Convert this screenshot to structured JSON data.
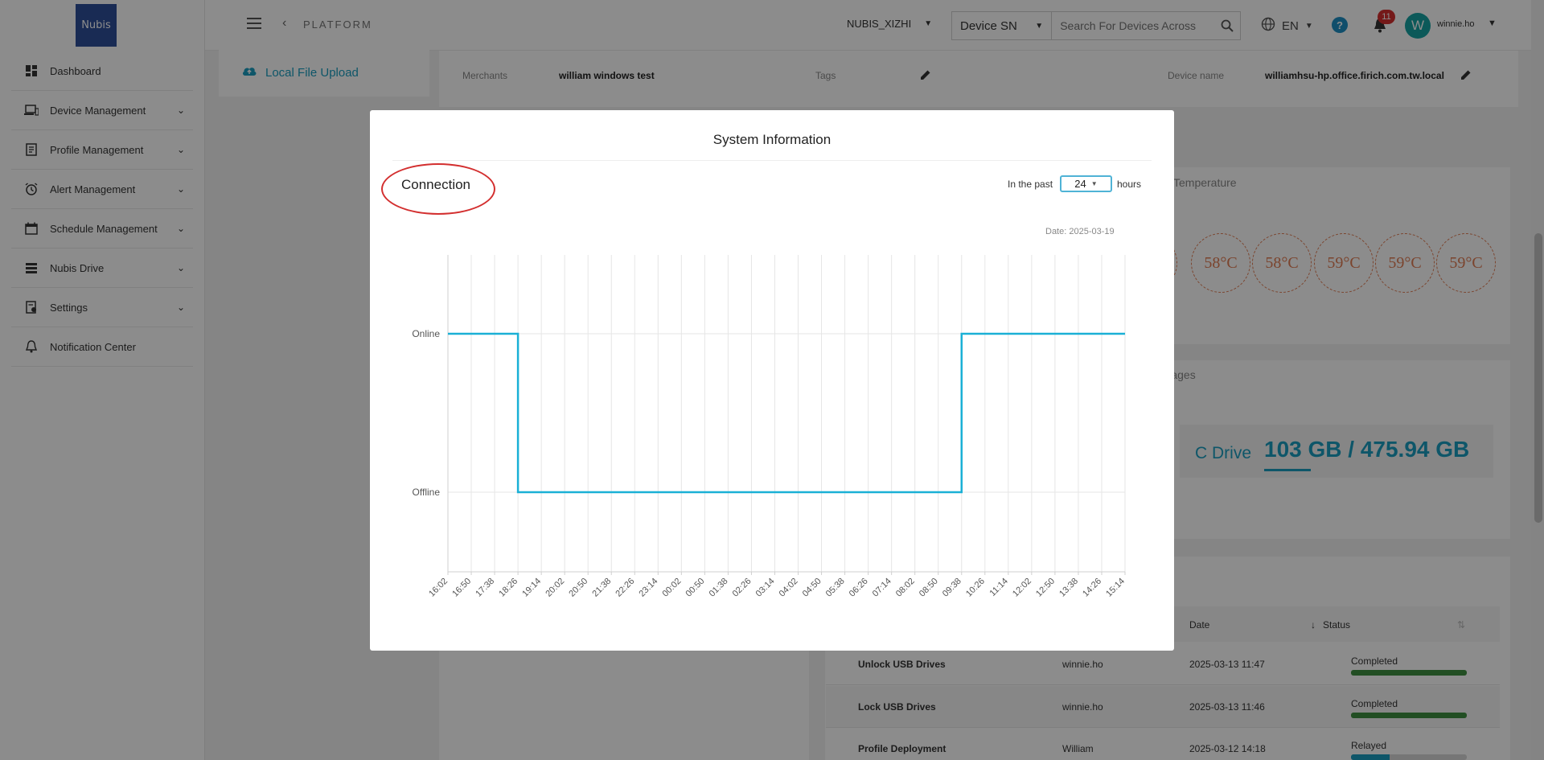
{
  "sidebar": {
    "logo_text": "Nubis",
    "items": [
      {
        "label": "Dashboard",
        "icon": "dashboard-icon",
        "has_children": false
      },
      {
        "label": "Device Management",
        "icon": "device-icon",
        "has_children": true
      },
      {
        "label": "Profile Management",
        "icon": "profile-icon",
        "has_children": true
      },
      {
        "label": "Alert Management",
        "icon": "alarm-icon",
        "has_children": true
      },
      {
        "label": "Schedule Management",
        "icon": "calendar-icon",
        "has_children": true
      },
      {
        "label": "Nubis Drive",
        "icon": "drive-icon",
        "has_children": true
      },
      {
        "label": "Settings",
        "icon": "settings-icon",
        "has_children": true
      },
      {
        "label": "Notification Center",
        "icon": "bell-icon",
        "has_children": false
      }
    ]
  },
  "header": {
    "breadcrumb": "PLATFORM",
    "org": "NUBIS_XIZHI",
    "search_type": "Device SN",
    "search_placeholder": "Search For Devices Across",
    "language": "EN",
    "notification_count": "11",
    "avatar_initial": "W",
    "username": "winnie.ho"
  },
  "background": {
    "upload_label": "Local File Upload",
    "info": {
      "merchants_label": "Merchants",
      "merchants_value": "william windows test",
      "tags_label": "Tags",
      "device_name_label": "Device name",
      "device_name_value": "williamhsu-hp.office.firich.com.tw.local"
    },
    "temperature_title": "Temperature",
    "temperatures": [
      "C",
      "58°C",
      "58°C",
      "59°C",
      "59°C",
      "59°C"
    ],
    "storages_title": "torages",
    "storage": {
      "drive": "C Drive",
      "used": "103 GB",
      "total": "475.94 GB",
      "separator": "/"
    },
    "table": {
      "headers": {
        "date": "Date",
        "status": "Status"
      },
      "rows": [
        {
          "action": "Unlock USB Drives",
          "user": "winnie.ho",
          "date": "2025-03-13 11:47",
          "status": "Completed",
          "progress": 1.0
        },
        {
          "action": "Lock USB Drives",
          "user": "winnie.ho",
          "date": "2025-03-13 11:46",
          "status": "Completed",
          "progress": 1.0
        },
        {
          "action": "Profile Deployment",
          "user": "William",
          "date": "2025-03-12 14:18",
          "status": "Relayed",
          "progress": 0.33
        }
      ]
    }
  },
  "modal": {
    "title": "System Information",
    "section_title": "Connection",
    "past_prefix": "In the past",
    "past_value": "24",
    "past_suffix": "hours",
    "date_label": "Date: 2025-03-19"
  },
  "chart_data": {
    "type": "line",
    "step": true,
    "x": [
      "16:02",
      "16:50",
      "17:38",
      "18:26",
      "19:14",
      "20:02",
      "20:50",
      "21:38",
      "22:26",
      "23:14",
      "00:02",
      "00:50",
      "01:38",
      "02:26",
      "03:14",
      "04:02",
      "04:50",
      "05:38",
      "06:26",
      "07:14",
      "08:02",
      "08:50",
      "09:38",
      "10:26",
      "11:14",
      "12:02",
      "12:50",
      "13:38",
      "14:26",
      "15:14"
    ],
    "y_categories": [
      "Offline",
      "Online"
    ],
    "series": [
      {
        "values": [
          "Online",
          "Online",
          "Online",
          "Offline",
          "Offline",
          "Offline",
          "Offline",
          "Offline",
          "Offline",
          "Offline",
          "Offline",
          "Offline",
          "Offline",
          "Offline",
          "Offline",
          "Offline",
          "Offline",
          "Offline",
          "Offline",
          "Offline",
          "Offline",
          "Offline",
          "Online",
          "Online",
          "Online",
          "Online",
          "Online",
          "Online",
          "Online",
          "Online"
        ]
      }
    ],
    "grid": true,
    "colors": {
      "line": "#1ab0d6",
      "grid": "#e6e6e6"
    }
  }
}
